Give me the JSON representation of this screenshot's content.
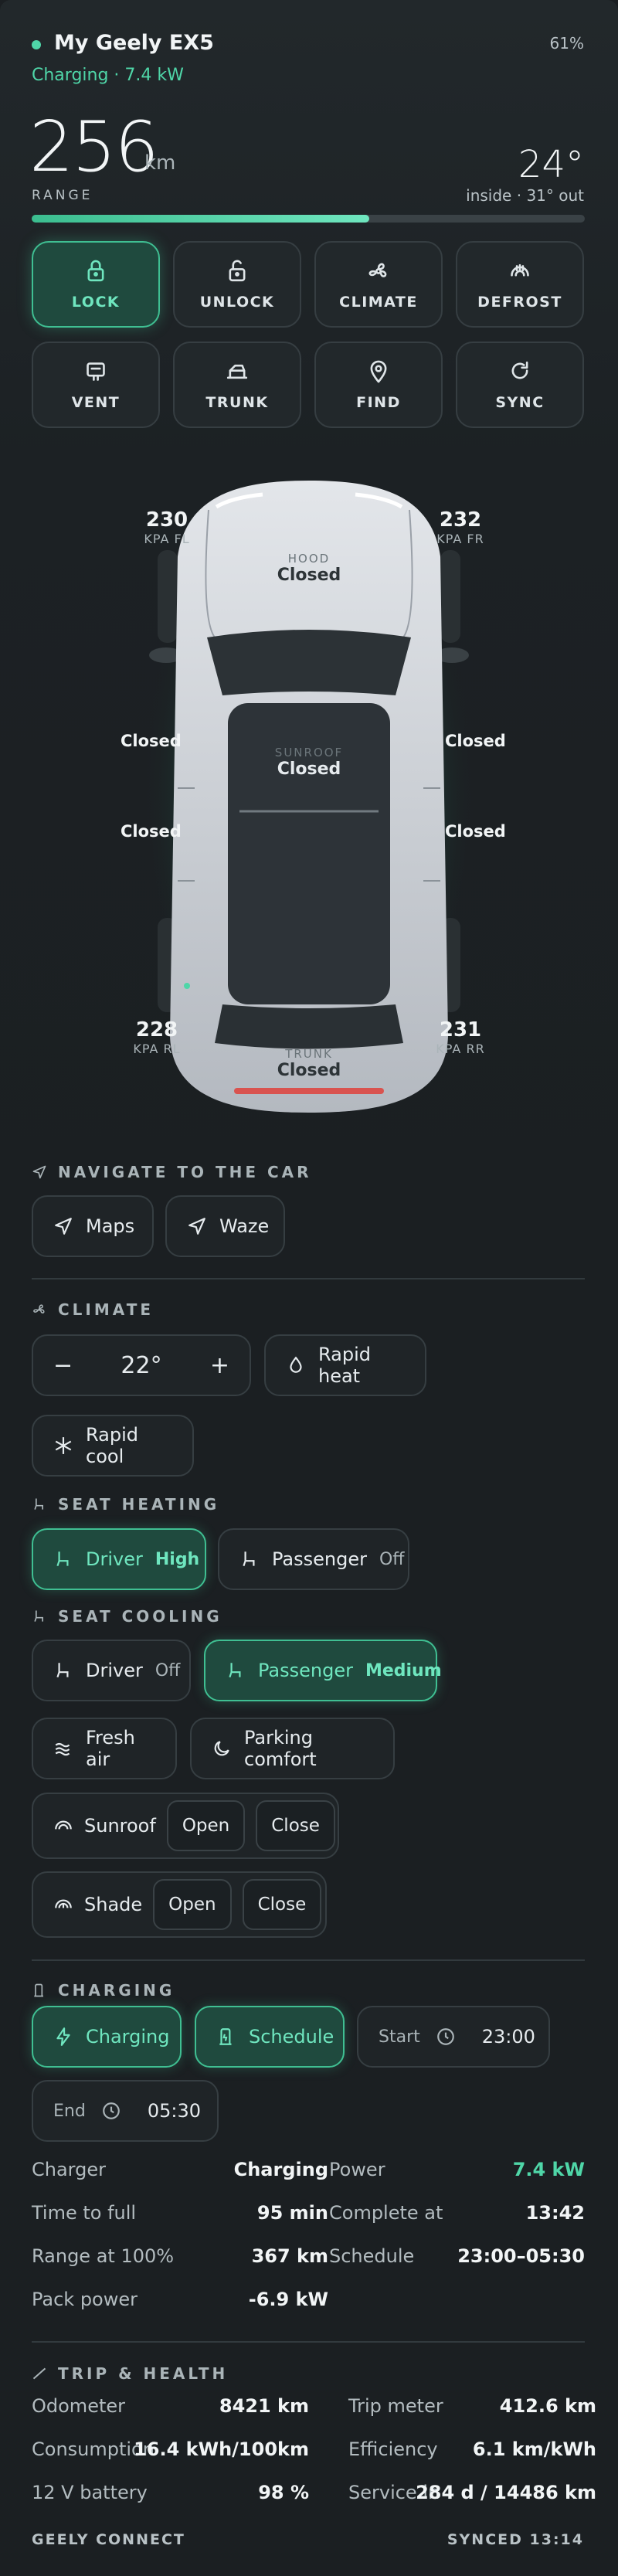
{
  "header": {
    "title": "My Geely EX5",
    "charging_line": "Charging · 7.4 kW",
    "battery": "61%",
    "range_value": "256",
    "range_unit": "km",
    "range_label": "RANGE",
    "temp": "24°",
    "temp_sub": "inside · 31° out",
    "range_fill_fraction": 0.61
  },
  "quick_actions": [
    {
      "label": "LOCK",
      "icon": "lock-icon",
      "active": true
    },
    {
      "label": "UNLOCK",
      "icon": "unlock-icon",
      "active": false
    },
    {
      "label": "CLIMATE",
      "icon": "fan-icon",
      "active": false
    },
    {
      "label": "DEFROST",
      "icon": "defrost-icon",
      "active": false
    },
    {
      "label": "VENT",
      "icon": "vent-icon",
      "active": false
    },
    {
      "label": "TRUNK",
      "icon": "trunk-icon",
      "active": false
    },
    {
      "label": "FIND",
      "icon": "location-pin-icon",
      "active": false
    },
    {
      "label": "SYNC",
      "icon": "refresh-icon",
      "active": false
    }
  ],
  "car": {
    "tires": {
      "fl": {
        "value": "230",
        "label": "KPA FL"
      },
      "fr": {
        "value": "232",
        "label": "KPA FR"
      },
      "rl": {
        "value": "228",
        "label": "KPA RL"
      },
      "rr": {
        "value": "231",
        "label": "KPA RR"
      }
    },
    "hood": {
      "caption": "HOOD",
      "value": "Closed"
    },
    "sunroof": {
      "caption": "SUNROOF",
      "value": "Closed"
    },
    "trunk": {
      "caption": "TRUNK",
      "value": "Closed"
    },
    "doors": {
      "fl": "Closed",
      "fr": "Closed",
      "rl": "Closed",
      "rr": "Closed"
    }
  },
  "navigate": {
    "title": "NAVIGATE TO THE CAR",
    "buttons": [
      "Maps",
      "Waze"
    ]
  },
  "climate": {
    "title": "CLIMATE",
    "minus": "−",
    "temp": "22°",
    "plus": "+",
    "rapid_heat": "Rapid heat",
    "rapid_cool": "Rapid cool",
    "seat_heating_title": "SEAT HEATING",
    "heat_driver": {
      "label": "Driver",
      "state": "High"
    },
    "heat_passenger": {
      "label": "Passenger",
      "state": "Off"
    },
    "seat_cooling_title": "SEAT COOLING",
    "cool_driver": {
      "label": "Driver",
      "state": "Off"
    },
    "cool_passenger": {
      "label": "Passenger",
      "state": "Medium"
    },
    "fresh_air": "Fresh air",
    "parking_comfort": "Parking comfort",
    "sunroof": {
      "label": "Sunroof",
      "open": "Open",
      "close": "Close"
    },
    "shade": {
      "label": "Shade",
      "open": "Open",
      "close": "Close"
    }
  },
  "charging": {
    "title": "CHARGING",
    "charging_btn": "Charging",
    "schedule_btn": "Schedule",
    "start_label": "Start",
    "start_time": "23:00",
    "end_label": "End",
    "end_time": "05:30",
    "stats": [
      {
        "key": "Charger",
        "value": "Charging"
      },
      {
        "key": "Power",
        "value": "7.4 kW"
      },
      {
        "key": "Time to full",
        "value": "95 min"
      },
      {
        "key": "Complete at",
        "value": "13:42"
      },
      {
        "key": "Range at 100%",
        "value": "367 km"
      },
      {
        "key": "Schedule",
        "value": "23:00–05:30"
      },
      {
        "key": "Pack power",
        "value": "-6.9 kW"
      }
    ]
  },
  "trip": {
    "title": "TRIP & HEALTH",
    "stats": [
      {
        "key": "Odometer",
        "value": "8421 km"
      },
      {
        "key": "Trip meter",
        "value": "412.6 km"
      },
      {
        "key": "Consumption",
        "value": "16.4 kWh/100km"
      },
      {
        "key": "Efficiency",
        "value": "6.1 km/kWh"
      },
      {
        "key": "12 V battery",
        "value": "98 %"
      },
      {
        "key": "Service in",
        "value": "284 d / 14486 km"
      }
    ]
  },
  "footer": {
    "brand": "GEELY CONNECT",
    "synced": "SYNCED 13:14"
  },
  "colors": {
    "accent": "#4fd6a8",
    "trunk_alert": "#d9534f"
  }
}
